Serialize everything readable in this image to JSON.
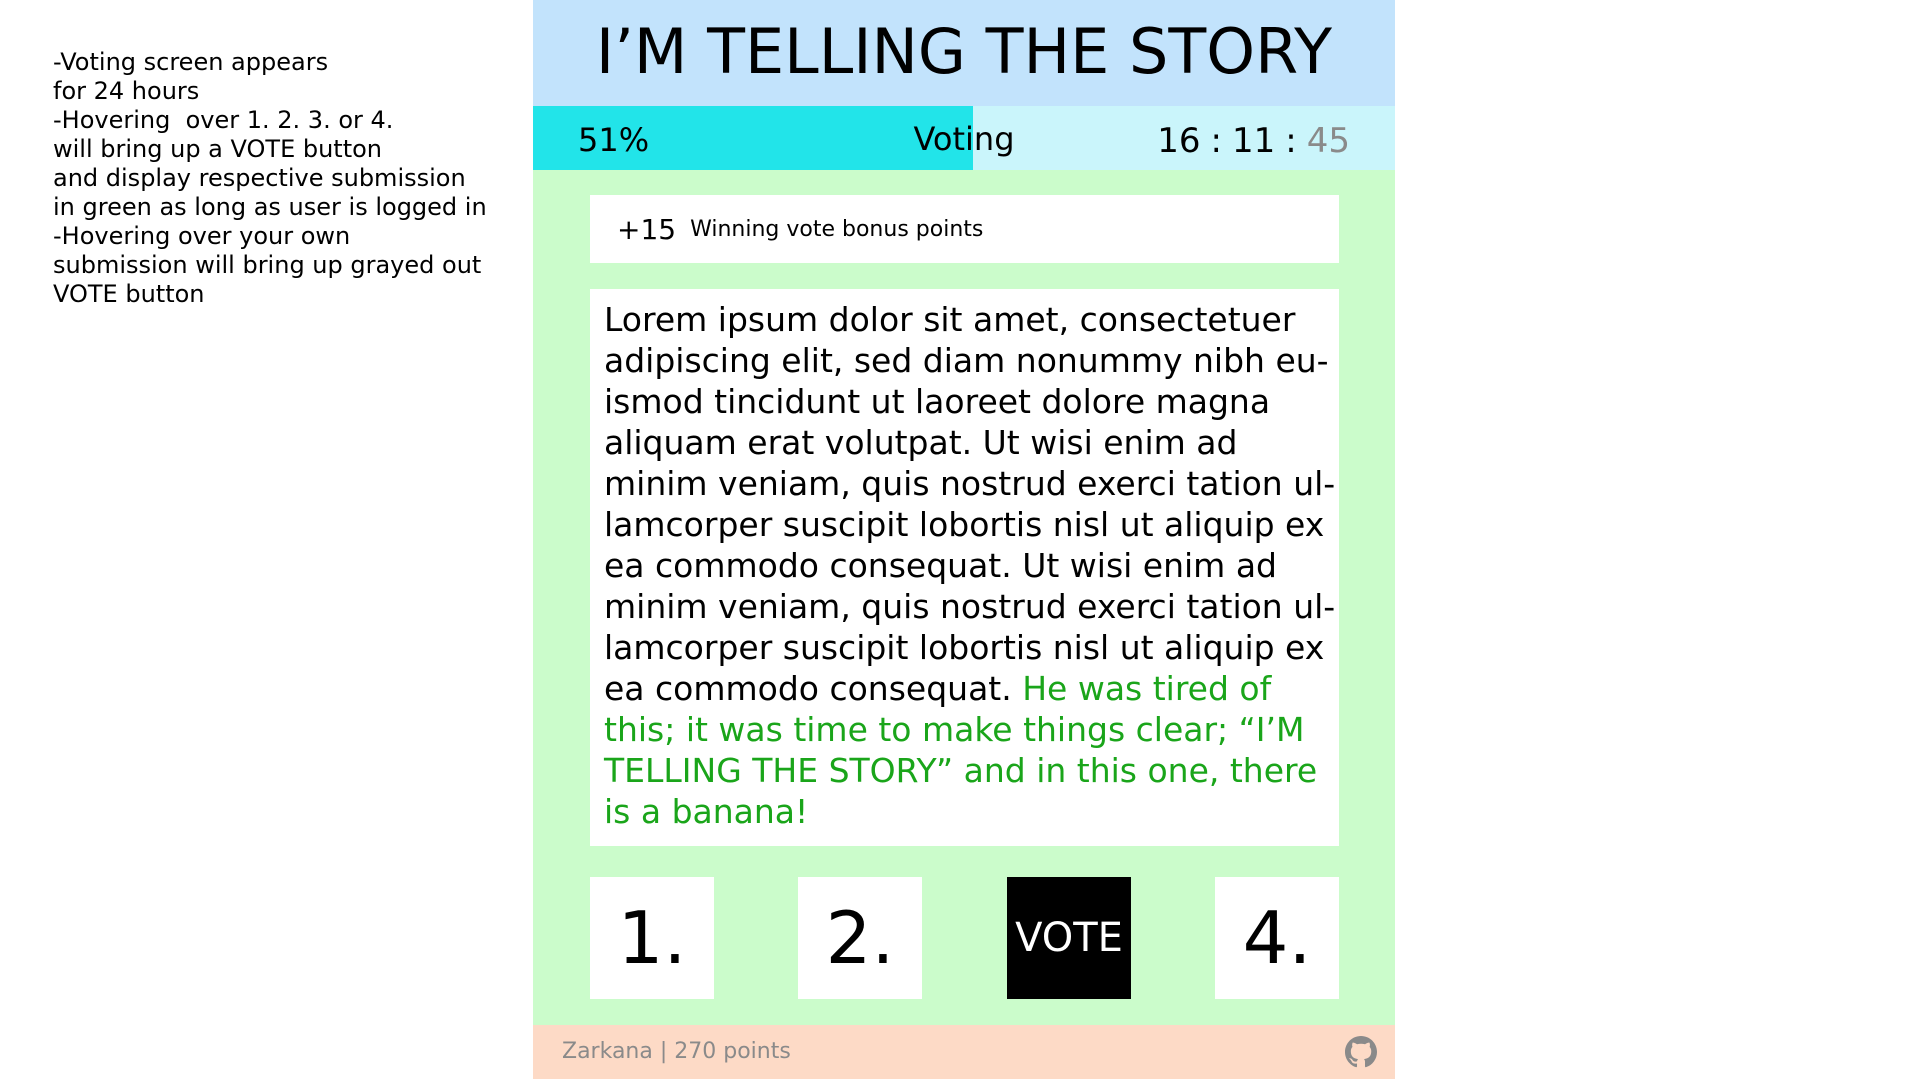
{
  "notes": [
    "-Voting screen appears",
    "for 24 hours",
    "-Hovering  over 1. 2. 3. or 4.",
    "will bring up a VOTE button",
    "and display respective submission",
    "in green as long as user is logged in",
    "-Hovering over your own",
    "submission will bring up grayed out",
    "VOTE button"
  ],
  "header": {
    "title": "I’M TELLING THE STORY"
  },
  "status": {
    "progress_label": "51%",
    "progress_value": 0.51,
    "phase": "Voting",
    "timer": {
      "hours": "16",
      "minutes": "11",
      "seconds": "45",
      "separator": ":"
    }
  },
  "bonus": {
    "points": "+15",
    "label": "Winning vote bonus points"
  },
  "story": {
    "lines": [
      "Lorem ipsum dolor sit amet, consectetuer",
      "adipiscing elit, sed diam nonummy nibh eu-",
      "ismod tincidunt ut laoreet dolore magna",
      "aliquam erat volutpat. Ut wisi enim ad",
      "minim veniam, quis nostrud exerci tation ul-",
      "lamcorper suscipit lobortis nisl ut aliquip ex",
      "ea commodo consequat. Ut wisi enim ad",
      "minim veniam, quis nostrud exerci tation ul-",
      "lamcorper suscipit lobortis nisl ut aliquip ex"
    ],
    "last_line_black": "ea commodo consequat. ",
    "last_line_green": "He was tired of",
    "green_lines": [
      "this; it was time to make things clear; “I’M",
      "TELLING THE STORY” and in this one, there",
      "is a banana!"
    ]
  },
  "choices": [
    {
      "label": "1."
    },
    {
      "label": "2."
    },
    {
      "label": "VOTE"
    },
    {
      "label": "4."
    }
  ],
  "footer": {
    "user": "Zarkana | 270 points",
    "icon": "github-icon"
  },
  "colors": {
    "header_bg": "#c2e3fc",
    "status_bg": "#caf5fb",
    "progress_fill": "#22e4e9",
    "app_bg": "#cbfccb",
    "footer_bg": "#fddac6",
    "green_text": "#1aa51a"
  }
}
